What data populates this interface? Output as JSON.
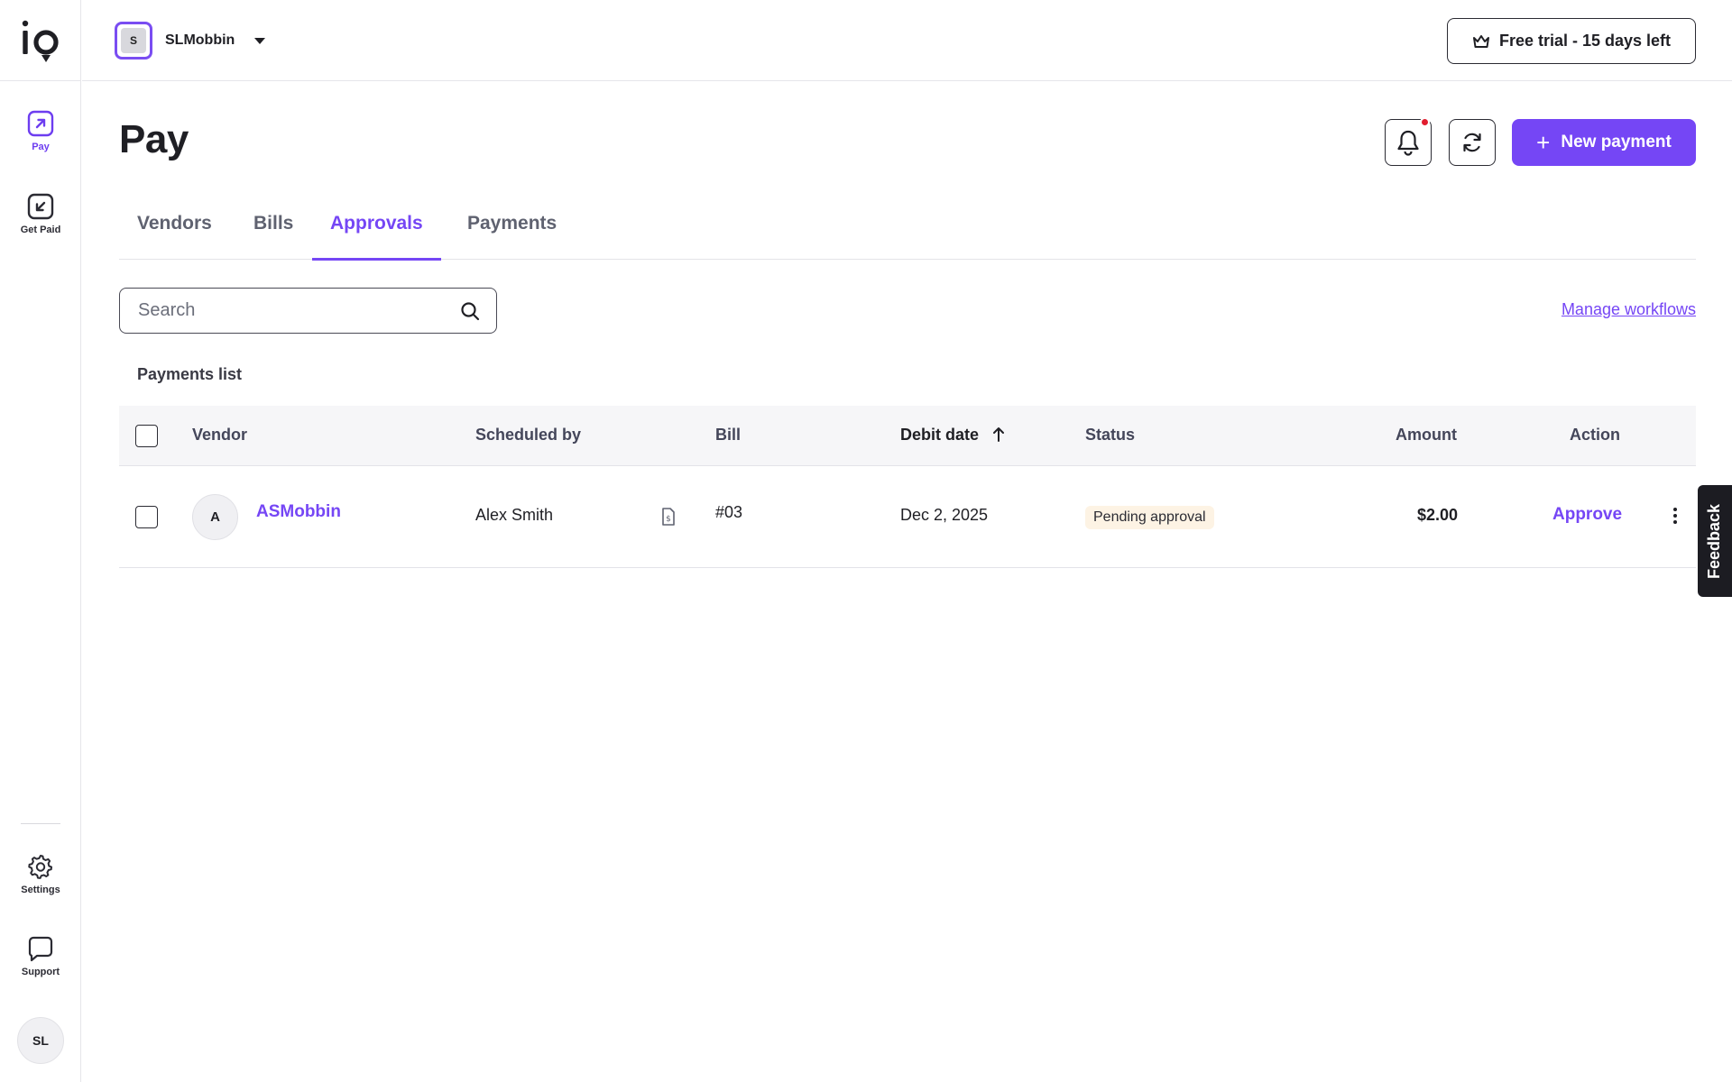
{
  "sidebar": {
    "logo_text": "io",
    "items": [
      {
        "label": "Pay",
        "icon": "arrow-up-right-icon"
      },
      {
        "label": "Get Paid",
        "icon": "arrow-down-left-icon"
      },
      {
        "label": "Settings",
        "icon": "gear-icon"
      },
      {
        "label": "Support",
        "icon": "chat-bubble-icon"
      }
    ],
    "user_initials": "SL"
  },
  "topbar": {
    "org_initial": "S",
    "org_name": "SLMobbin",
    "trial_label": "Free trial - 15 days left"
  },
  "page": {
    "title": "Pay",
    "new_payment_label": "New payment",
    "notification_dot_color": "#e11d2f",
    "accent_color": "#7546f5"
  },
  "tabs": [
    {
      "label": "Vendors",
      "active": false
    },
    {
      "label": "Bills",
      "active": false
    },
    {
      "label": "Approvals",
      "active": true
    },
    {
      "label": "Payments",
      "active": false
    }
  ],
  "search": {
    "placeholder": "Search",
    "value": ""
  },
  "manage_workflows_label": "Manage workflows",
  "list_title": "Payments list",
  "table": {
    "columns": [
      "Vendor",
      "Scheduled by",
      "Bill",
      "Debit date",
      "Status",
      "Amount",
      "Action"
    ],
    "sorted_column": "Debit date",
    "sort_direction": "ascending",
    "rows": [
      {
        "vendor_initial": "A",
        "vendor": "ASMobbin",
        "scheduled_by": "Alex Smith",
        "bill": "#03",
        "debit_date": "Dec 2, 2025",
        "status": "Pending approval",
        "amount": "$2.00",
        "action": "Approve"
      }
    ]
  },
  "feedback_label": "Feedback"
}
